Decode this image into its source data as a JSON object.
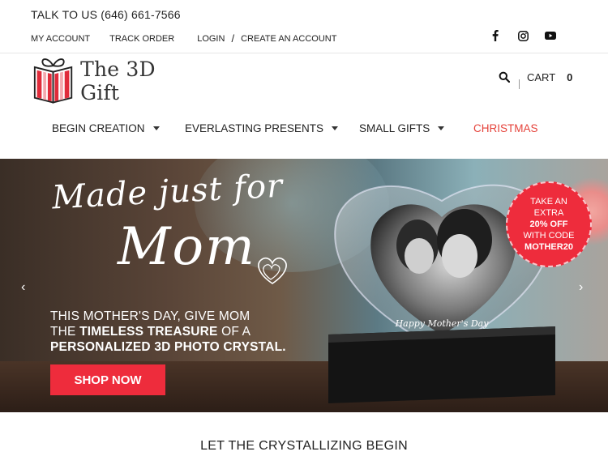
{
  "topbar": {
    "phone": "TALK TO US (646) 661-7566",
    "links": [
      "MY ACCOUNT",
      "TRACK ORDER",
      "LOGIN",
      "CREATE AN ACCOUNT"
    ],
    "separator": "/"
  },
  "social": [
    "facebook-icon",
    "instagram-icon",
    "youtube-icon"
  ],
  "logo": {
    "text": "The 3D Gift"
  },
  "header": {
    "cart_label": "CART",
    "cart_count": "0"
  },
  "nav": {
    "items": [
      {
        "label": "BEGIN CREATION",
        "dropdown": true
      },
      {
        "label": "EVERLASTING PRESENTS",
        "dropdown": true
      },
      {
        "label": "SMALL GIFTS",
        "dropdown": true
      },
      {
        "label": "CHRISTMAS",
        "dropdown": false
      }
    ]
  },
  "hero": {
    "script_line1": "Made just for",
    "script_line2": "Mom",
    "tagline_line1": "THIS MOTHER'S DAY, GIVE MOM",
    "tagline_line2_pre": "THE ",
    "tagline_line2_bold": "TIMELESS TREASURE",
    "tagline_line2_post": " OF A",
    "tagline_line3": "PERSONALIZED 3D PHOTO CRYSTAL.",
    "cta": "SHOP NOW",
    "crystal_caption": "Happy Mother's Day",
    "promo": {
      "line1": "TAKE AN",
      "line2": "EXTRA",
      "line3": "20% OFF",
      "line4": "WITH CODE",
      "line5": "MOTHER20"
    },
    "prev_arrow": "‹",
    "next_arrow": "›"
  },
  "section": {
    "title": "LET THE CRYSTALLIZING BEGIN"
  },
  "colors": {
    "accent": "#ee2c3c",
    "christmas": "#e5423a"
  }
}
